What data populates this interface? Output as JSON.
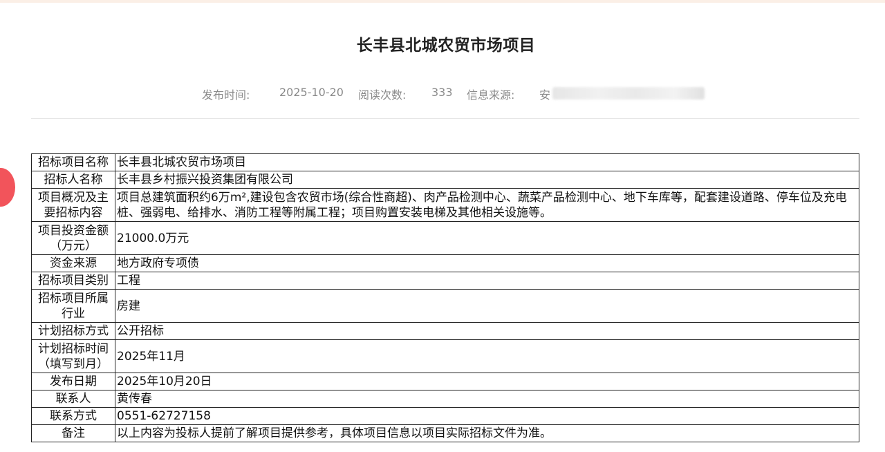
{
  "article": {
    "title": "长丰县北城农贸市场项目",
    "meta": {
      "publish_time_label": "发布时间:",
      "publish_time": "2025-10-20",
      "read_count_label": "阅读次数:",
      "read_count": "333",
      "source_label": "信息来源:",
      "source_value": "安"
    }
  },
  "table": {
    "rows": [
      {
        "label": "招标项目名称",
        "value": "长丰县北城农贸市场项目"
      },
      {
        "label": "招标人名称",
        "value": "长丰县乡村振兴投资集团有限公司"
      },
      {
        "label": "项目概况及主要招标内容",
        "value": "项目总建筑面积约6万m²,建设包含农贸市场(综合性商超)、肉产品检测中心、蔬菜产品检测中心、地下车库等，配套建设道路、停车位及充电桩、强弱电、给排水、消防工程等附属工程；项目购置安装电梯及其他相关设施等。"
      },
      {
        "label": "项目投资金额（万元）",
        "value": "21000.0万元"
      },
      {
        "label": "资金来源",
        "value": "地方政府专项债"
      },
      {
        "label": "招标项目类别",
        "value": "工程"
      },
      {
        "label": "招标项目所属行业",
        "value": "房建"
      },
      {
        "label": "计划招标方式",
        "value": "公开招标"
      },
      {
        "label": "计划招标时间（填写到月）",
        "value": "2025年11月"
      },
      {
        "label": "发布日期",
        "value": "2025年10月20日"
      },
      {
        "label": "联系人",
        "value": "黄传春"
      },
      {
        "label": "联系方式",
        "value": "0551-62727158"
      },
      {
        "label": "备注",
        "value": "以上内容为投标人提前了解项目提供参考，具体项目信息以项目实际招标文件为准。"
      }
    ]
  }
}
